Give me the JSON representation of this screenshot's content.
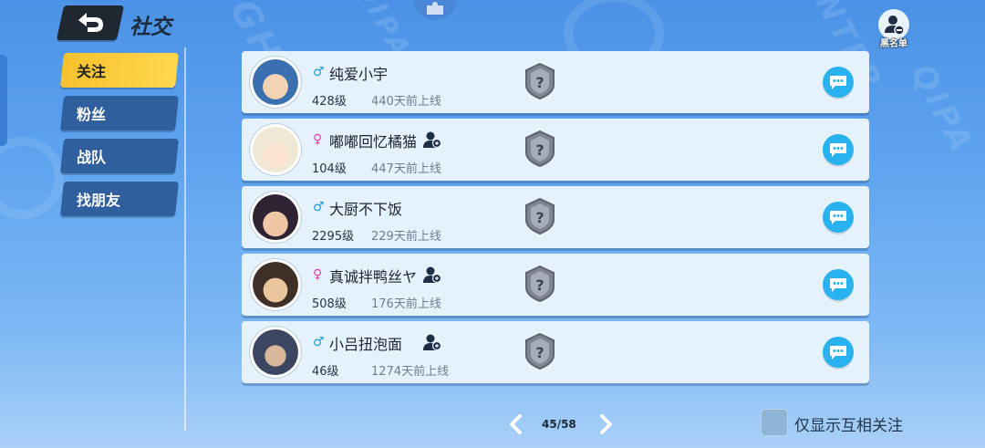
{
  "header": {
    "title": "社交",
    "blacklist_label": "黑名单"
  },
  "side_nav": {
    "items": [
      {
        "label": "关注",
        "active": true
      },
      {
        "label": "粉丝",
        "active": false
      },
      {
        "label": "战队",
        "active": false
      },
      {
        "label": "找朋友",
        "active": false
      }
    ]
  },
  "friends": [
    {
      "gender": "male",
      "gender_symbol": "♂",
      "name": "纯爱小宇",
      "has_team_icon": false,
      "level": "428级",
      "last_online": "440天前上线",
      "avatar_color": "#3a6fb0"
    },
    {
      "gender": "female",
      "gender_symbol": "♀",
      "name": "嘟嘟回忆橘猫",
      "has_team_icon": true,
      "level": "104级",
      "last_online": "447天前上线",
      "avatar_color": "#e9e2cf"
    },
    {
      "gender": "male",
      "gender_symbol": "♂",
      "name": "大厨不下饭",
      "has_team_icon": false,
      "level": "2295级",
      "last_online": "229天前上线",
      "avatar_color": "#3b2c3a"
    },
    {
      "gender": "female",
      "gender_symbol": "♀",
      "name": "真诚拌鸭丝ヤ",
      "has_team_icon": true,
      "level": "508级",
      "last_online": "176天前上线",
      "avatar_color": "#4a3a2e"
    },
    {
      "gender": "male",
      "gender_symbol": "♂",
      "name": "小吕扭泡面",
      "has_team_icon": true,
      "level": "46级",
      "last_online": "1274天前上线",
      "avatar_color": "#3d4660"
    }
  ],
  "pagination": {
    "label": "45/58"
  },
  "filter": {
    "mutual_only_label": "仅显示互相关注",
    "checked": false
  },
  "colors": {
    "active_tab": "#f6c12e",
    "nav_tab": "#2f5f9c",
    "chat_button": "#28b2ef",
    "male": "#1e9de0",
    "female": "#e83ea6"
  }
}
